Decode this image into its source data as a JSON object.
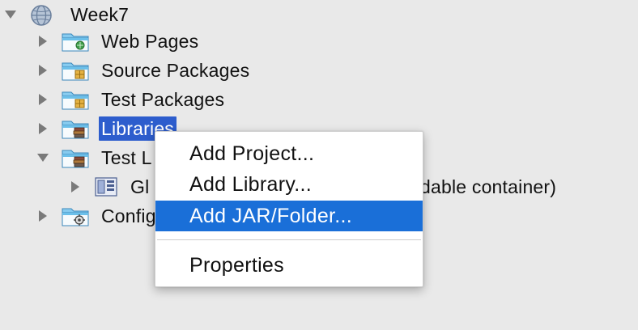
{
  "tree": {
    "root": {
      "label": "Week7",
      "expanded": true
    },
    "items": [
      {
        "label": "Web Pages",
        "icon": "web-pages-folder-icon",
        "expanded": false
      },
      {
        "label": "Source Packages",
        "icon": "source-packages-folder-icon",
        "expanded": false
      },
      {
        "label": "Test Packages",
        "icon": "test-packages-folder-icon",
        "expanded": false
      },
      {
        "label": "Libraries",
        "icon": "libraries-folder-icon",
        "expanded": false,
        "selected": true
      },
      {
        "label": "Test L",
        "icon": "test-libraries-folder-icon",
        "expanded": true
      },
      {
        "label": "Gl",
        "suffix": "dable container)",
        "icon": "library-jar-icon",
        "expanded": false
      },
      {
        "label": "Config",
        "icon": "configuration-files-folder-icon",
        "expanded": false
      }
    ]
  },
  "context_menu": {
    "items": [
      {
        "label": "Add Project..."
      },
      {
        "label": "Add Library..."
      },
      {
        "label": "Add JAR/Folder...",
        "highlighted": true
      },
      {
        "label": "Properties"
      }
    ]
  },
  "colors": {
    "background": "#e9e9e9",
    "selection": "#2d5dcd",
    "menu_highlight": "#1a6fd8",
    "folder": "#5fb6e6"
  }
}
